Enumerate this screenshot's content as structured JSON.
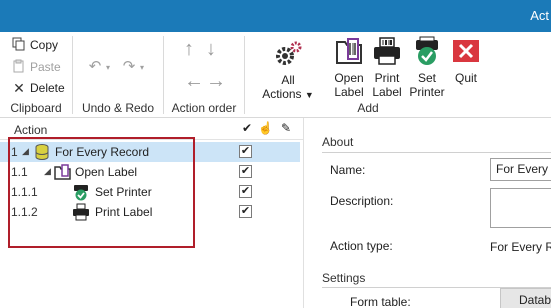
{
  "window": {
    "title": "Act"
  },
  "ribbon": {
    "clipboard": {
      "copy": "Copy",
      "paste": "Paste",
      "delete": "Delete",
      "group_label": "Clipboard"
    },
    "undo_redo": {
      "group_label": "Undo & Redo"
    },
    "action_order": {
      "group_label": "Action order"
    },
    "add": {
      "all_actions": "All",
      "all_actions_2": "Actions",
      "open_label_1": "Open",
      "open_label_2": "Label",
      "print_label_1": "Print",
      "print_label_2": "Label",
      "set_printer_1": "Set",
      "set_printer_2": "Printer",
      "quit": "Quit",
      "group_label": "Add"
    }
  },
  "action_list": {
    "header": "Action",
    "header_icons": [
      "checkmark-icon",
      "hand-icon",
      "pencil-icon"
    ],
    "rows": [
      {
        "num": "1",
        "label": "For Every Record",
        "icon": "database-icon",
        "checked": "✔",
        "selected": true
      },
      {
        "num": "1.1",
        "label": "Open Label",
        "icon": "open-label-icon",
        "checked": "✔",
        "selected": false
      },
      {
        "num": "1.1.1",
        "label": "Set Printer",
        "icon": "set-printer-icon",
        "checked": "✔",
        "selected": false
      },
      {
        "num": "1.1.2",
        "label": "Print Label",
        "icon": "print-label-icon",
        "checked": "✔",
        "selected": false
      }
    ]
  },
  "properties": {
    "about_title": "About",
    "name_label": "Name:",
    "name_value": "For Every R",
    "description_label": "Description:",
    "description_value": "",
    "action_type_label": "Action type:",
    "action_type_value": "For Every Re",
    "settings_title": "Settings",
    "form_table_label": "Form table:",
    "form_table_value": "Datab"
  },
  "colors": {
    "titlebar": "#1b7ab8",
    "selection": "#cce4f7",
    "highlight_box": "#b01e2a",
    "quit_red": "#d9373f",
    "check_green": "#2a9d63"
  }
}
